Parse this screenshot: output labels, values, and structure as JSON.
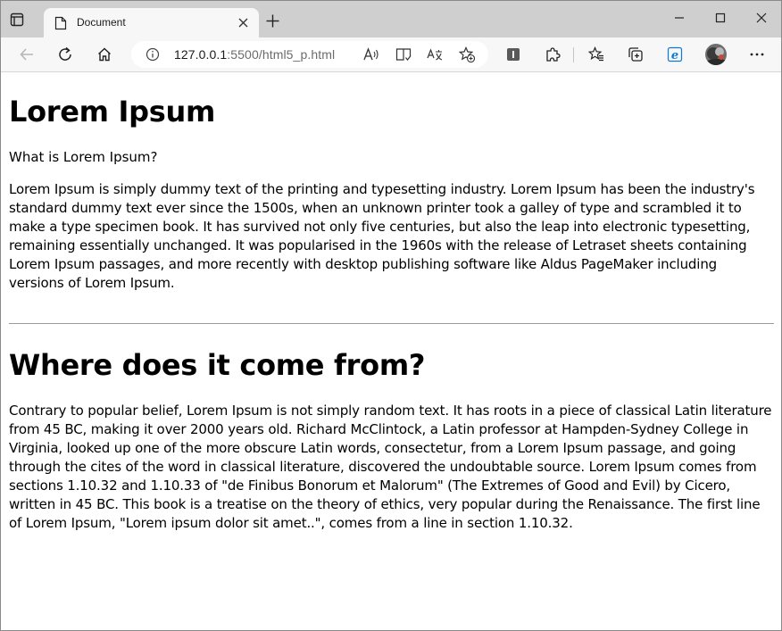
{
  "browser": {
    "tab": {
      "title": "Document"
    },
    "address": {
      "host": "127.0.0.1",
      "rest": ":5500/html5_p.html"
    }
  },
  "page": {
    "h1": "Lorem Ipsum",
    "question": "What is Lorem Ipsum?",
    "para1": "Lorem Ipsum is simply dummy text of the printing and typesetting industry. Lorem Ipsum has been the industry's standard dummy text ever since the 1500s, when an unknown printer took a galley of type and scrambled it to make a type specimen book. It has survived not only five centuries, but also the leap into electronic typesetting, remaining essentially unchanged. It was popularised in the 1960s with the release of Letraset sheets containing Lorem Ipsum passages, and more recently with desktop publishing software like Aldus PageMaker including versions of Lorem Ipsum.",
    "h2": "Where does it come from?",
    "para2": "Contrary to popular belief, Lorem Ipsum is not simply random text. It has roots in a piece of classical Latin literature from 45 BC, making it over 2000 years old. Richard McClintock, a Latin professor at Hampden-Sydney College in Virginia, looked up one of the more obscure Latin words, consectetur, from a Lorem Ipsum passage, and going through the cites of the word in classical literature, discovered the undoubtable source. Lorem Ipsum comes from sections 1.10.32 and 1.10.33 of \"de Finibus Bonorum et Malorum\" (The Extremes of Good and Evil) by Cicero, written in 45 BC. This book is a treatise on the theory of ethics, very popular during the Renaissance. The first line of Lorem Ipsum, \"Lorem ipsum dolor sit amet..\", comes from a line in section 1.10.32."
  },
  "icons": {
    "tab_actions": "tab-actions-icon",
    "favicon": "document-icon",
    "back": "back-arrow-icon",
    "refresh": "refresh-icon",
    "home": "home-icon",
    "info": "info-icon",
    "read_aloud": "read-aloud-icon",
    "immersive": "immersive-reader-icon",
    "translate": "translate-icon",
    "favorite_add": "star-plus-icon",
    "extension_i": "extension-icon",
    "puzzle": "puzzle-icon",
    "favorites": "favorites-icon",
    "collections": "collections-icon",
    "ie_mode": "ie-mode-icon",
    "more": "more-icon"
  },
  "colors": {
    "chrome_bg": "#cfcfcf",
    "toolbar_bg": "#f7f7f7",
    "rule": "#9a9a9a",
    "edge_blue": "#0c7ad6"
  }
}
